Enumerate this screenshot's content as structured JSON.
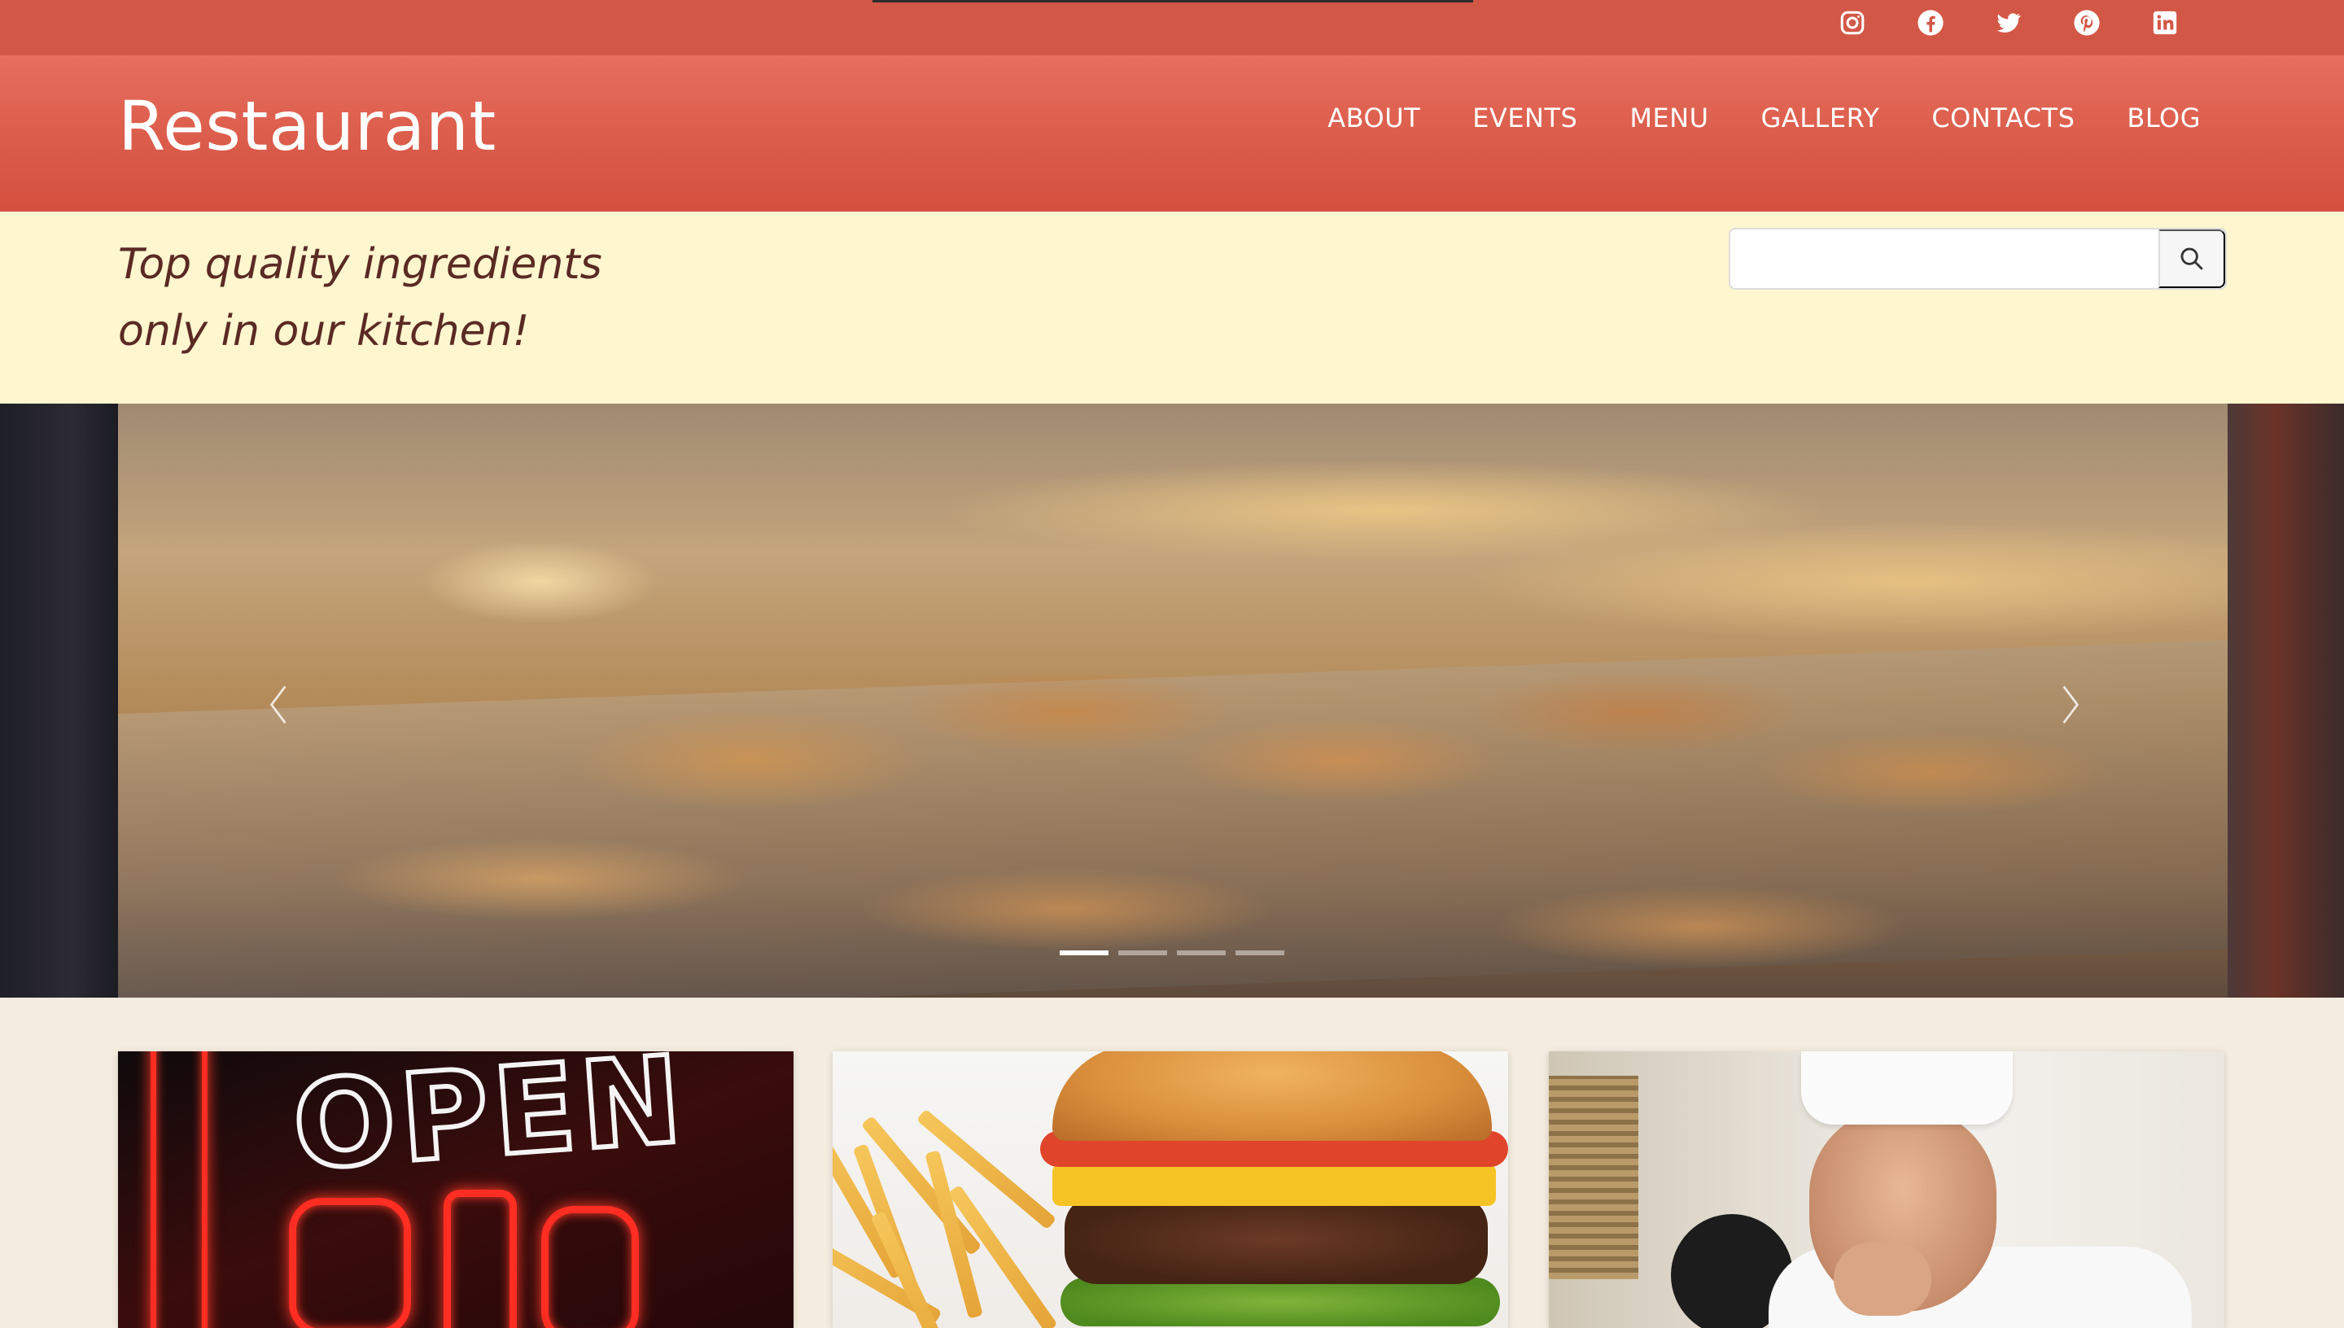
{
  "social": {
    "items": [
      {
        "name": "instagram",
        "icon": "instagram-icon"
      },
      {
        "name": "facebook",
        "icon": "facebook-icon"
      },
      {
        "name": "twitter",
        "icon": "twitter-icon"
      },
      {
        "name": "pinterest",
        "icon": "pinterest-icon"
      },
      {
        "name": "linkedin",
        "icon": "linkedin-icon"
      }
    ]
  },
  "header": {
    "brand": "Restaurant",
    "nav": [
      "ABOUT",
      "EVENTS",
      "MENU",
      "GALLERY",
      "CONTACTS",
      "BLOG"
    ]
  },
  "tagline": {
    "line1": "Top quality ingredients",
    "line2": "only in our kitchen!"
  },
  "search": {
    "value": "",
    "placeholder": "",
    "icon": "search-icon"
  },
  "slider": {
    "slide_count": 4,
    "active_index": 0,
    "prev_icon": "chevron-left-icon",
    "next_icon": "chevron-right-icon"
  },
  "cards": [
    {
      "image": "neon open sign"
    },
    {
      "image": "cheeseburger with fries"
    },
    {
      "image": "smiling chef"
    }
  ],
  "colors": {
    "header_red": "#db5c4b",
    "topbar_red": "#d35746",
    "tagline_band": "#fdf6cf",
    "tagline_text": "#5a2a23",
    "page_bg": "#f4ecdf"
  }
}
